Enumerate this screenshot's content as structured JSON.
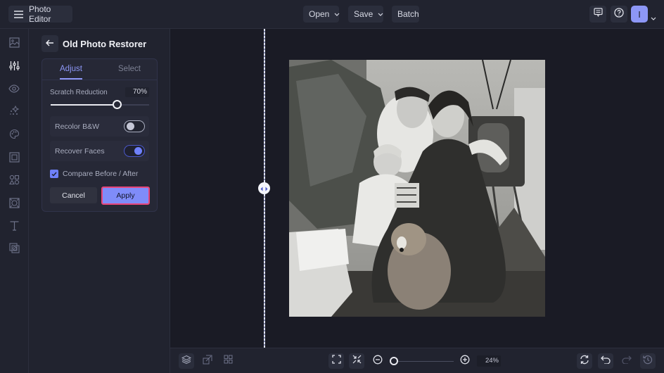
{
  "app": {
    "title": "Photo Editor",
    "menu": [
      {
        "label": "Open",
        "has_dropdown": true
      },
      {
        "label": "Save",
        "has_dropdown": true
      },
      {
        "label": "Batch",
        "has_dropdown": false
      }
    ],
    "right_icons": [
      "chat-icon",
      "help-icon"
    ],
    "avatar_initial": "I"
  },
  "rail": {
    "items": [
      {
        "name": "image",
        "icon": "image-icon",
        "active": false
      },
      {
        "name": "adjust",
        "icon": "sliders-icon",
        "active": true
      },
      {
        "name": "preview",
        "icon": "eye-icon",
        "active": false
      },
      {
        "name": "effects",
        "icon": "sparkles-icon",
        "active": false
      },
      {
        "name": "artsy",
        "icon": "palette-icon",
        "active": false
      },
      {
        "name": "frames",
        "icon": "frame-icon",
        "active": false
      },
      {
        "name": "graphics",
        "icon": "shapes-icon",
        "active": false
      },
      {
        "name": "overlays",
        "icon": "overlay-icon",
        "active": false
      },
      {
        "name": "text",
        "icon": "text-icon",
        "active": false
      },
      {
        "name": "textures",
        "icon": "texture-icon",
        "active": false
      }
    ]
  },
  "panel": {
    "title": "Old Photo Restorer",
    "tabs": [
      {
        "label": "Adjust",
        "active": true
      },
      {
        "label": "Select",
        "active": false
      }
    ],
    "scratch": {
      "label": "Scratch Reduction",
      "value": 70,
      "display": "70%"
    },
    "toggles": [
      {
        "label": "Recolor B&W",
        "on": false
      },
      {
        "label": "Recover Faces",
        "on": true
      }
    ],
    "compare": {
      "label": "Compare Before / After",
      "checked": true
    },
    "cancel_label": "Cancel",
    "apply_label": "Apply"
  },
  "canvas": {
    "photo_description": "Vintage black and white family photo by a Christmas tree with a dog",
    "compare_split": "before/after divider"
  },
  "bottombar": {
    "left_icons": [
      "layers-icon",
      "resize-icon",
      "grid-icon"
    ],
    "fit_icons": [
      "fit-screen-icon",
      "actual-size-icon"
    ],
    "zoom": {
      "value": 24,
      "display": "24%"
    },
    "right_icons": [
      "refresh-icon",
      "undo-icon",
      "redo-icon",
      "history-icon"
    ]
  },
  "colors": {
    "accent": "#8d97f6",
    "apply_border": "#e8457a",
    "toggle_on": "#6f81fb",
    "background": "#1d1f2a"
  }
}
